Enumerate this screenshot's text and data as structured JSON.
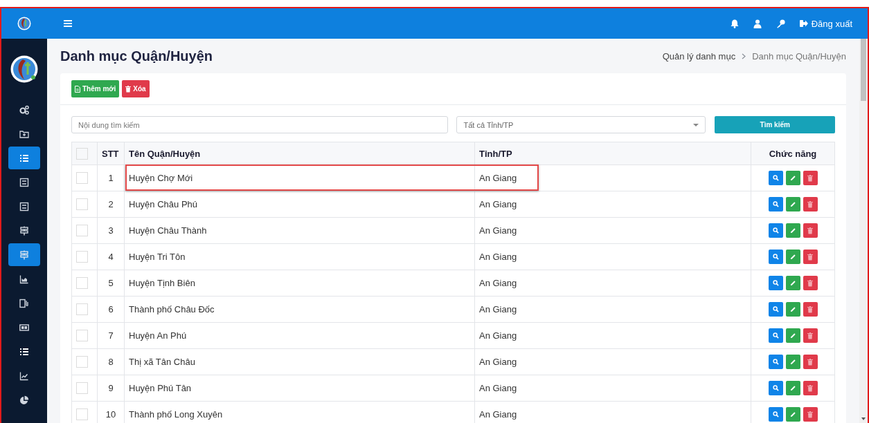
{
  "topbar": {
    "logout": "Đăng xuất"
  },
  "sidebar": {
    "items": [
      {
        "selected": false
      },
      {
        "selected": false
      },
      {
        "selected": true
      },
      {
        "selected": false
      },
      {
        "selected": false
      },
      {
        "selected": false
      },
      {
        "selected": true
      },
      {
        "selected": false
      },
      {
        "selected": false
      },
      {
        "selected": false
      },
      {
        "selected": false
      },
      {
        "selected": false
      },
      {
        "selected": false
      }
    ]
  },
  "page": {
    "title": "Danh mục Quận/Huyện",
    "breadcrumb": [
      "Quản lý danh mục",
      "Danh mục Quận/Huyện"
    ]
  },
  "toolbar": {
    "add": "Thêm mới",
    "delete": "Xóa"
  },
  "filters": {
    "search_placeholder": "Nội dung tìm kiếm",
    "province_placeholder": "Tất cả Tỉnh/TP",
    "search_button": "Tìm kiếm"
  },
  "table": {
    "all_checked": false,
    "columns": [
      "STT",
      "Tên Quận/Huyện",
      "Tỉnh/TP",
      "Chức năng"
    ],
    "rows": [
      {
        "stt": "1",
        "name": "Huyện Chợ Mới",
        "province": "An Giang",
        "checked": false,
        "highlighted": true
      },
      {
        "stt": "2",
        "name": "Huyện Châu Phú",
        "province": "An Giang",
        "checked": false,
        "highlighted": false
      },
      {
        "stt": "3",
        "name": "Huyện Châu Thành",
        "province": "An Giang",
        "checked": false,
        "highlighted": false
      },
      {
        "stt": "4",
        "name": "Huyện Tri Tôn",
        "province": "An Giang",
        "checked": false,
        "highlighted": false
      },
      {
        "stt": "5",
        "name": "Huyện Tịnh Biên",
        "province": "An Giang",
        "checked": false,
        "highlighted": false
      },
      {
        "stt": "6",
        "name": "Thành phố Châu Đốc",
        "province": "An Giang",
        "checked": false,
        "highlighted": false
      },
      {
        "stt": "7",
        "name": "Huyện An Phú",
        "province": "An Giang",
        "checked": false,
        "highlighted": false
      },
      {
        "stt": "8",
        "name": "Thị xã Tân Châu",
        "province": "An Giang",
        "checked": false,
        "highlighted": false
      },
      {
        "stt": "9",
        "name": "Huyện Phú Tân",
        "province": "An Giang",
        "checked": false,
        "highlighted": false
      },
      {
        "stt": "10",
        "name": "Thành phố Long Xuyên",
        "province": "An Giang",
        "checked": false,
        "highlighted": false
      }
    ]
  }
}
